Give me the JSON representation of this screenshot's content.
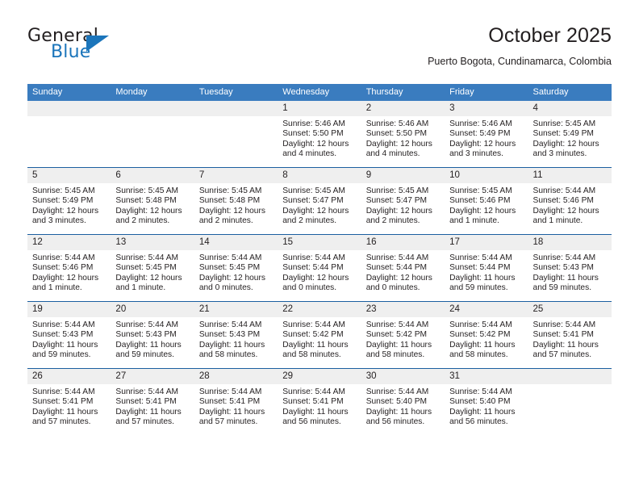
{
  "brand": {
    "name_top": "General",
    "name_bottom": "Blue",
    "accent_color": "#1b75bb",
    "logo_icon": "triangle-logo-icon"
  },
  "header": {
    "title": "October 2025",
    "location": "Puerto Bogota, Cundinamarca, Colombia"
  },
  "calendar": {
    "header_color": "#3a7cbf",
    "daynum_bg": "#efefef",
    "weekday_headers": [
      "Sunday",
      "Monday",
      "Tuesday",
      "Wednesday",
      "Thursday",
      "Friday",
      "Saturday"
    ],
    "weeks": [
      [
        {
          "day": "",
          "sunrise": "",
          "sunset": "",
          "daylight": "",
          "empty": true
        },
        {
          "day": "",
          "sunrise": "",
          "sunset": "",
          "daylight": "",
          "empty": true
        },
        {
          "day": "",
          "sunrise": "",
          "sunset": "",
          "daylight": "",
          "empty": true
        },
        {
          "day": "1",
          "sunrise": "Sunrise: 5:46 AM",
          "sunset": "Sunset: 5:50 PM",
          "daylight": "Daylight: 12 hours and 4 minutes."
        },
        {
          "day": "2",
          "sunrise": "Sunrise: 5:46 AM",
          "sunset": "Sunset: 5:50 PM",
          "daylight": "Daylight: 12 hours and 4 minutes."
        },
        {
          "day": "3",
          "sunrise": "Sunrise: 5:46 AM",
          "sunset": "Sunset: 5:49 PM",
          "daylight": "Daylight: 12 hours and 3 minutes."
        },
        {
          "day": "4",
          "sunrise": "Sunrise: 5:45 AM",
          "sunset": "Sunset: 5:49 PM",
          "daylight": "Daylight: 12 hours and 3 minutes."
        }
      ],
      [
        {
          "day": "5",
          "sunrise": "Sunrise: 5:45 AM",
          "sunset": "Sunset: 5:49 PM",
          "daylight": "Daylight: 12 hours and 3 minutes."
        },
        {
          "day": "6",
          "sunrise": "Sunrise: 5:45 AM",
          "sunset": "Sunset: 5:48 PM",
          "daylight": "Daylight: 12 hours and 2 minutes."
        },
        {
          "day": "7",
          "sunrise": "Sunrise: 5:45 AM",
          "sunset": "Sunset: 5:48 PM",
          "daylight": "Daylight: 12 hours and 2 minutes."
        },
        {
          "day": "8",
          "sunrise": "Sunrise: 5:45 AM",
          "sunset": "Sunset: 5:47 PM",
          "daylight": "Daylight: 12 hours and 2 minutes."
        },
        {
          "day": "9",
          "sunrise": "Sunrise: 5:45 AM",
          "sunset": "Sunset: 5:47 PM",
          "daylight": "Daylight: 12 hours and 2 minutes."
        },
        {
          "day": "10",
          "sunrise": "Sunrise: 5:45 AM",
          "sunset": "Sunset: 5:46 PM",
          "daylight": "Daylight: 12 hours and 1 minute."
        },
        {
          "day": "11",
          "sunrise": "Sunrise: 5:44 AM",
          "sunset": "Sunset: 5:46 PM",
          "daylight": "Daylight: 12 hours and 1 minute."
        }
      ],
      [
        {
          "day": "12",
          "sunrise": "Sunrise: 5:44 AM",
          "sunset": "Sunset: 5:46 PM",
          "daylight": "Daylight: 12 hours and 1 minute."
        },
        {
          "day": "13",
          "sunrise": "Sunrise: 5:44 AM",
          "sunset": "Sunset: 5:45 PM",
          "daylight": "Daylight: 12 hours and 1 minute."
        },
        {
          "day": "14",
          "sunrise": "Sunrise: 5:44 AM",
          "sunset": "Sunset: 5:45 PM",
          "daylight": "Daylight: 12 hours and 0 minutes."
        },
        {
          "day": "15",
          "sunrise": "Sunrise: 5:44 AM",
          "sunset": "Sunset: 5:44 PM",
          "daylight": "Daylight: 12 hours and 0 minutes."
        },
        {
          "day": "16",
          "sunrise": "Sunrise: 5:44 AM",
          "sunset": "Sunset: 5:44 PM",
          "daylight": "Daylight: 12 hours and 0 minutes."
        },
        {
          "day": "17",
          "sunrise": "Sunrise: 5:44 AM",
          "sunset": "Sunset: 5:44 PM",
          "daylight": "Daylight: 11 hours and 59 minutes."
        },
        {
          "day": "18",
          "sunrise": "Sunrise: 5:44 AM",
          "sunset": "Sunset: 5:43 PM",
          "daylight": "Daylight: 11 hours and 59 minutes."
        }
      ],
      [
        {
          "day": "19",
          "sunrise": "Sunrise: 5:44 AM",
          "sunset": "Sunset: 5:43 PM",
          "daylight": "Daylight: 11 hours and 59 minutes."
        },
        {
          "day": "20",
          "sunrise": "Sunrise: 5:44 AM",
          "sunset": "Sunset: 5:43 PM",
          "daylight": "Daylight: 11 hours and 59 minutes."
        },
        {
          "day": "21",
          "sunrise": "Sunrise: 5:44 AM",
          "sunset": "Sunset: 5:43 PM",
          "daylight": "Daylight: 11 hours and 58 minutes."
        },
        {
          "day": "22",
          "sunrise": "Sunrise: 5:44 AM",
          "sunset": "Sunset: 5:42 PM",
          "daylight": "Daylight: 11 hours and 58 minutes."
        },
        {
          "day": "23",
          "sunrise": "Sunrise: 5:44 AM",
          "sunset": "Sunset: 5:42 PM",
          "daylight": "Daylight: 11 hours and 58 minutes."
        },
        {
          "day": "24",
          "sunrise": "Sunrise: 5:44 AM",
          "sunset": "Sunset: 5:42 PM",
          "daylight": "Daylight: 11 hours and 58 minutes."
        },
        {
          "day": "25",
          "sunrise": "Sunrise: 5:44 AM",
          "sunset": "Sunset: 5:41 PM",
          "daylight": "Daylight: 11 hours and 57 minutes."
        }
      ],
      [
        {
          "day": "26",
          "sunrise": "Sunrise: 5:44 AM",
          "sunset": "Sunset: 5:41 PM",
          "daylight": "Daylight: 11 hours and 57 minutes."
        },
        {
          "day": "27",
          "sunrise": "Sunrise: 5:44 AM",
          "sunset": "Sunset: 5:41 PM",
          "daylight": "Daylight: 11 hours and 57 minutes."
        },
        {
          "day": "28",
          "sunrise": "Sunrise: 5:44 AM",
          "sunset": "Sunset: 5:41 PM",
          "daylight": "Daylight: 11 hours and 57 minutes."
        },
        {
          "day": "29",
          "sunrise": "Sunrise: 5:44 AM",
          "sunset": "Sunset: 5:41 PM",
          "daylight": "Daylight: 11 hours and 56 minutes."
        },
        {
          "day": "30",
          "sunrise": "Sunrise: 5:44 AM",
          "sunset": "Sunset: 5:40 PM",
          "daylight": "Daylight: 11 hours and 56 minutes."
        },
        {
          "day": "31",
          "sunrise": "Sunrise: 5:44 AM",
          "sunset": "Sunset: 5:40 PM",
          "daylight": "Daylight: 11 hours and 56 minutes."
        },
        {
          "day": "",
          "sunrise": "",
          "sunset": "",
          "daylight": "",
          "empty": true
        }
      ]
    ]
  }
}
